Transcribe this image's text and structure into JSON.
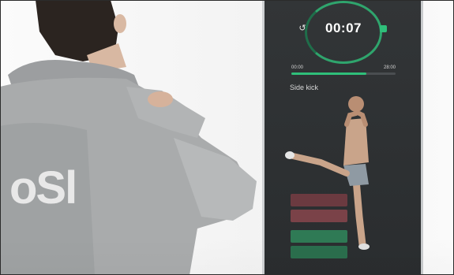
{
  "mirror": {
    "timer": "00:07",
    "time_left": "00:00",
    "time_right": "28:00",
    "progress_fraction": 0.72,
    "exercise_label": "Side kick",
    "panels": [
      {
        "left": "",
        "right": ""
      },
      {
        "left": "",
        "right": ""
      },
      {
        "left": "",
        "right": ""
      },
      {
        "left": "",
        "right": ""
      }
    ]
  },
  "hoodie": {
    "print": "oSl"
  },
  "colors": {
    "accent": "#2fbf7a",
    "mirror_bg": "#2c2f31",
    "hoodie": "#a9abac"
  },
  "icons": {
    "refresh": "refresh-icon",
    "stop": "stop-icon"
  }
}
